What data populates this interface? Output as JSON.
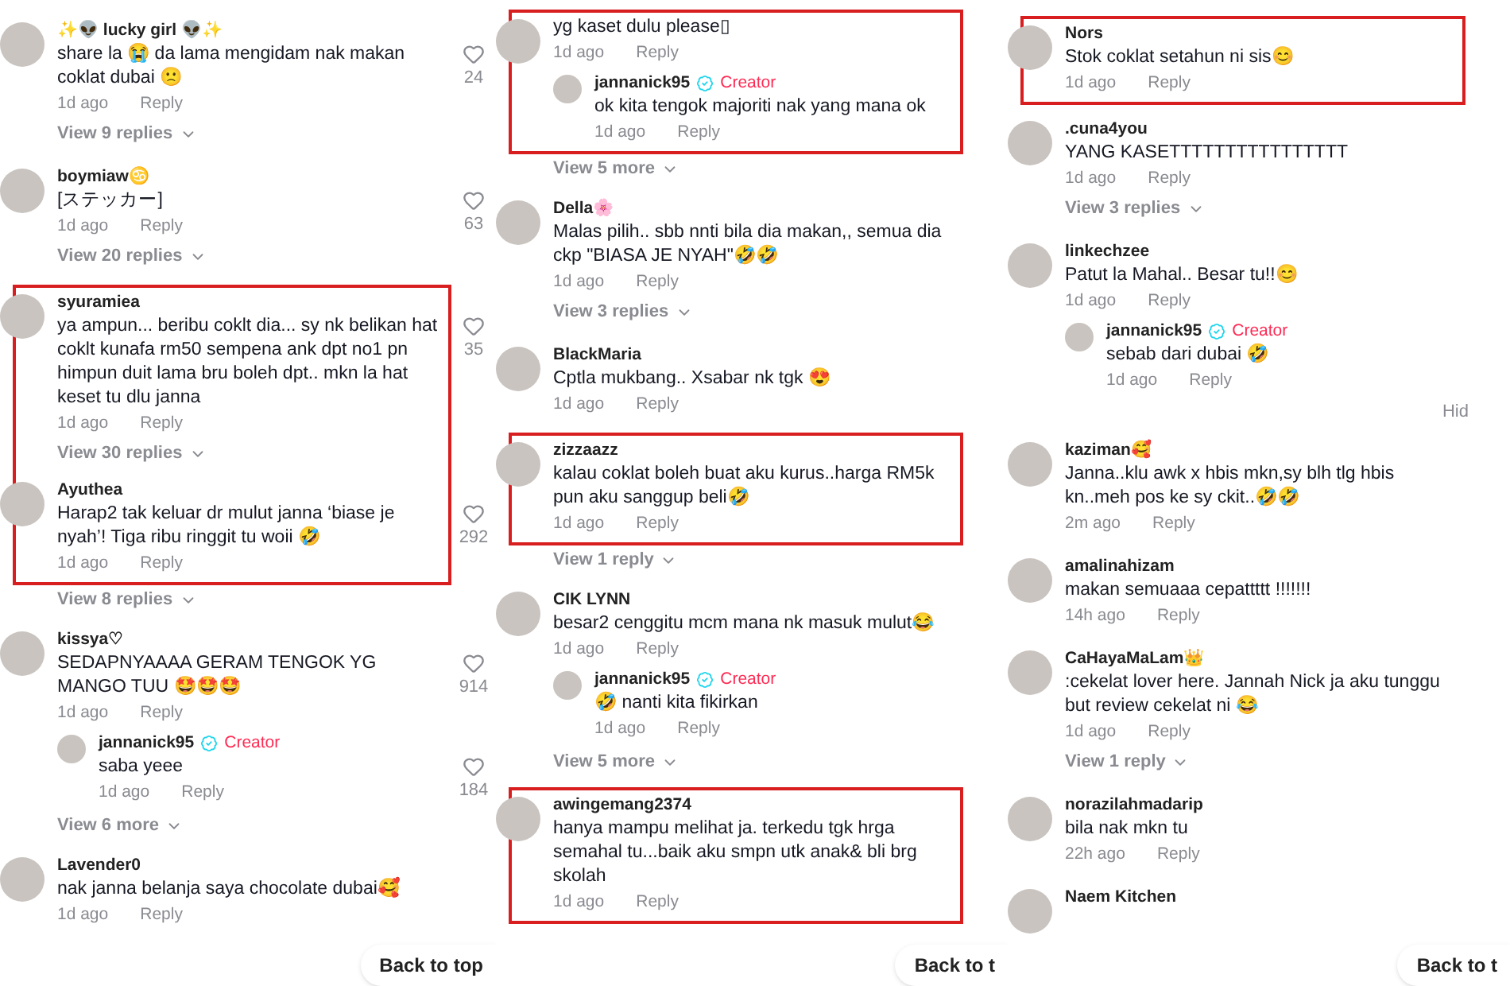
{
  "columns": [
    {
      "groups": [
        {
          "highlighted": false,
          "comments": [
            {
              "user": "✨👽 lucky girl 👽✨",
              "text": "share la 😭 da lama mengidam nak makan coklat dubai 🙁",
              "time": "1d ago",
              "reply": "Reply",
              "likes": "24",
              "view_replies": "View 9 replies"
            }
          ]
        },
        {
          "highlighted": false,
          "comments": [
            {
              "user": "boymiaw♋",
              "text": "[ステッカー]",
              "time": "1d ago",
              "reply": "Reply",
              "likes": "63",
              "view_replies": "View 20 replies"
            }
          ]
        },
        {
          "highlighted": true,
          "comments": [
            {
              "user": "syuramiea",
              "text": "ya ampun... beribu coklt dia... sy nk belikan hat coklt kunafa rm50 sempena ank dpt no1 pn himpun duit lama bru boleh dpt.. mkn la hat keset tu dlu janna",
              "time": "1d ago",
              "reply": "Reply",
              "likes": "35",
              "view_replies": "View 30 replies"
            },
            {
              "user": "Ayuthea",
              "text": "Harap2 tak keluar dr mulut janna ‘biase je nyah’! Tiga ribu ringgit tu woii 🤣",
              "time": "1d ago",
              "reply": "Reply",
              "likes": "292"
            }
          ],
          "view_link": "View 8 replies"
        },
        {
          "highlighted": false,
          "comments": [
            {
              "user": "kissya♡",
              "text": "SEDAPNYAAAA GERAM TENGOK YG MANGO TUU 🤩🤩🤩",
              "time": "1d ago",
              "reply": "Reply",
              "likes": "914",
              "replies": [
                {
                  "user": "jannanick95",
                  "creator": "Creator",
                  "text": "saba yeee",
                  "time": "1d ago",
                  "reply": "Reply",
                  "likes": "184"
                }
              ]
            }
          ],
          "view_link": "View 6 more"
        },
        {
          "highlighted": false,
          "comments": [
            {
              "user": "Lavender0",
              "text": "nak janna belanja saya chocolate dubai🥰",
              "time": "1d ago",
              "reply": "Reply"
            }
          ]
        }
      ],
      "back_to_top": "Back to top"
    },
    {
      "groups": [
        {
          "highlighted": true,
          "comments": [
            {
              "text": "yg kaset dulu please▯",
              "time": "1d ago",
              "reply": "Reply",
              "replies": [
                {
                  "user": "jannanick95",
                  "creator": "Creator",
                  "text": "ok kita tengok majoriti nak yang mana ok",
                  "time": "1d ago",
                  "reply": "Reply"
                }
              ]
            }
          ],
          "view_link": "View 5 more"
        },
        {
          "highlighted": false,
          "comments": [
            {
              "user": "Della🌸",
              "text": "Malas pilih.. sbb nnti bila dia makan,, semua dia ckp \"BIASA JE NYAH\"🤣🤣",
              "time": "1d ago",
              "reply": "Reply",
              "view_replies": "View 3 replies"
            }
          ]
        },
        {
          "highlighted": false,
          "comments": [
            {
              "user": "BlackMaria",
              "text": "Cptla mukbang.. Xsabar nk tgk 😍",
              "time": "1d ago",
              "reply": "Reply"
            }
          ]
        },
        {
          "highlighted": true,
          "comments": [
            {
              "user": "zizzaazz",
              "text": "kalau coklat boleh buat aku kurus..harga RM5k pun aku sanggup beli🤣",
              "time": "1d ago",
              "reply": "Reply"
            }
          ],
          "view_link": "View 1 reply"
        },
        {
          "highlighted": false,
          "comments": [
            {
              "user": "CIK LYNN",
              "text": "besar2 cenggitu mcm mana nk masuk mulut😂",
              "time": "1d ago",
              "reply": "Reply",
              "replies": [
                {
                  "user": "jannanick95",
                  "creator": "Creator",
                  "text": "🤣 nanti kita fikirkan",
                  "time": "1d ago",
                  "reply": "Reply"
                }
              ]
            }
          ],
          "view_link": "View 5 more"
        },
        {
          "highlighted": true,
          "comments": [
            {
              "user": "awingemang2374",
              "text": "hanya mampu melihat ja. terkedu tgk hrga semahal tu...baik aku smpn utk anak& bli brg skolah",
              "time": "1d ago",
              "reply": "Reply"
            }
          ]
        }
      ],
      "back_to_top": "Back to t"
    },
    {
      "groups": [
        {
          "highlighted": true,
          "comments": [
            {
              "user": "Nors",
              "text": "Stok coklat setahun ni sis😊",
              "time": "1d ago",
              "reply": "Reply"
            }
          ]
        },
        {
          "highlighted": false,
          "comments": [
            {
              "user": ".cuna4you",
              "text": "YANG KASETTTTTTTTTTTTTTTT",
              "time": "1d ago",
              "reply": "Reply",
              "view_replies": "View 3 replies"
            }
          ]
        },
        {
          "highlighted": false,
          "comments": [
            {
              "user": "linkechzee",
              "text": "Patut la Mahal.. Besar tu!!😊",
              "time": "1d ago",
              "reply": "Reply",
              "replies": [
                {
                  "user": "jannanick95",
                  "creator": "Creator",
                  "text": "sebab dari dubai 🤣",
                  "time": "1d ago",
                  "reply": "Reply"
                }
              ]
            }
          ],
          "side_link": "Hid"
        },
        {
          "highlighted": false,
          "comments": [
            {
              "user": "kaziman🥰",
              "text": "Janna..klu awk x hbis mkn,sy blh tlg hbis kn..meh pos ke sy ckit..🤣🤣",
              "time": "2m ago",
              "reply": "Reply"
            }
          ]
        },
        {
          "highlighted": false,
          "comments": [
            {
              "user": "amalinahizam",
              "text": "makan semuaaa cepattttt !!!!!!!",
              "time": "14h ago",
              "reply": "Reply"
            }
          ]
        },
        {
          "highlighted": false,
          "comments": [
            {
              "user": "CaHayaMaLam👑",
              "text": ":cekelat lover here. Jannah Nick ja aku tunggu but review cekelat ni 😂",
              "time": "1d ago",
              "reply": "Reply",
              "view_replies": "View 1 reply"
            }
          ]
        },
        {
          "highlighted": false,
          "comments": [
            {
              "user": "norazilahmadarip",
              "text": "bila nak mkn tu",
              "time": "22h ago",
              "reply": "Reply"
            }
          ]
        },
        {
          "highlighted": false,
          "comments": [
            {
              "user": "Naem Kitchen"
            }
          ]
        }
      ],
      "back_to_top": "Back to t"
    }
  ]
}
